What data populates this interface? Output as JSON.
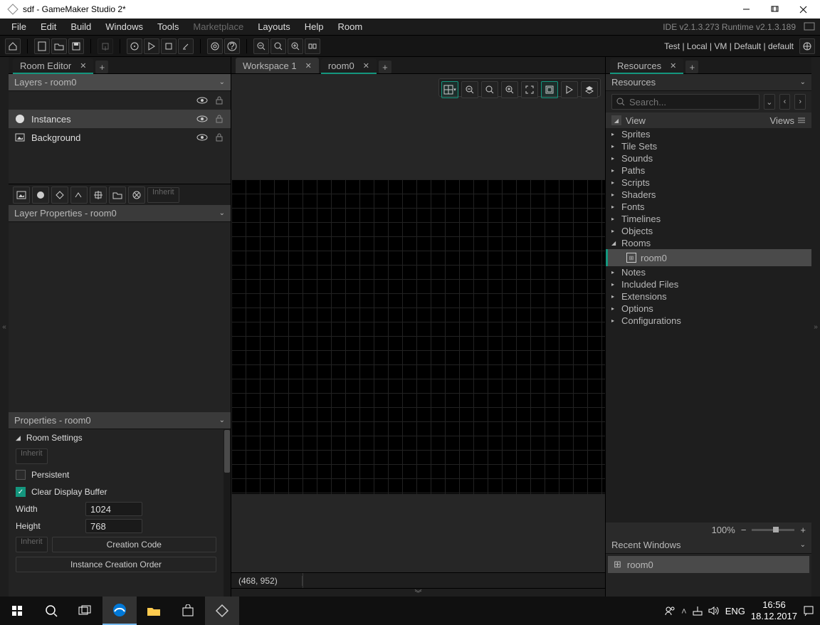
{
  "window": {
    "title": "sdf - GameMaker Studio 2*"
  },
  "menu": {
    "items": [
      "File",
      "Edit",
      "Build",
      "Windows",
      "Tools",
      "Marketplace",
      "Layouts",
      "Help",
      "Room"
    ],
    "disabled": "Marketplace"
  },
  "ide": {
    "version": "IDE v2.1.3.273 Runtime v2.1.3.189"
  },
  "target": {
    "text": "Test  |  Local  |  VM  |  Default  |  default"
  },
  "left": {
    "tab": "Room Editor",
    "layers": {
      "header": "Layers - room0",
      "items": [
        {
          "name": "Instances",
          "selected": true,
          "icon": "circle"
        },
        {
          "name": "Background",
          "icon": "image"
        }
      ]
    },
    "inherit": "Inherit",
    "layerprops": {
      "header": "Layer Properties - room0"
    },
    "props": {
      "header": "Properties - room0",
      "section": "Room Settings",
      "persistent": "Persistent",
      "clear": "Clear Display Buffer",
      "width_l": "Width",
      "width_v": "1024",
      "height_l": "Height",
      "height_v": "768",
      "creation": "Creation Code",
      "instorder": "Instance Creation Order",
      "inherit": "Inherit"
    }
  },
  "center": {
    "tabs": [
      {
        "label": "Workspace 1",
        "active": false
      },
      {
        "label": "room0",
        "active": true
      }
    ],
    "coord": "(468, 952)"
  },
  "right": {
    "tab": "Resources",
    "header": "Resources",
    "search": "Search...",
    "view": "View",
    "views": "Views",
    "tree": [
      "Sprites",
      "Tile Sets",
      "Sounds",
      "Paths",
      "Scripts",
      "Shaders",
      "Fonts",
      "Timelines",
      "Objects",
      "Rooms",
      "Notes",
      "Included Files",
      "Extensions",
      "Options",
      "Configurations"
    ],
    "expanded": "Rooms",
    "child": "room0",
    "zoom": "100%",
    "recent": {
      "header": "Recent Windows",
      "item": "room0"
    }
  },
  "taskbar": {
    "lang": "ENG",
    "time": "16:56",
    "date": "18.12.2017"
  }
}
